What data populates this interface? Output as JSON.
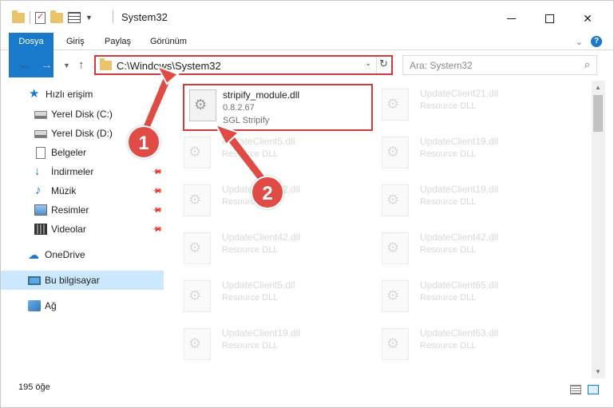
{
  "window": {
    "title": "System32"
  },
  "ribbon": {
    "tabs": [
      "Dosya",
      "Giriş",
      "Paylaş",
      "Görünüm"
    ]
  },
  "nav": {
    "address": "C:\\Windows\\System32",
    "search_placeholder": "Ara: System32"
  },
  "sidebar": {
    "items": [
      {
        "label": "Hızlı erişim",
        "icon": "star-icon"
      },
      {
        "label": "Yerel Disk (C:)",
        "icon": "disk-icon"
      },
      {
        "label": "Yerel Disk (D:)",
        "icon": "disk-icon"
      },
      {
        "label": "Belgeler",
        "icon": "document-icon"
      },
      {
        "label": "İndirmeler",
        "icon": "download-icon"
      },
      {
        "label": "Müzik",
        "icon": "music-icon"
      },
      {
        "label": "Resimler",
        "icon": "pictures-icon"
      },
      {
        "label": "Videolar",
        "icon": "video-icon"
      },
      {
        "label": "OneDrive",
        "icon": "cloud-icon"
      },
      {
        "label": "Bu bilgisayar",
        "icon": "computer-icon"
      },
      {
        "label": "Ağ",
        "icon": "network-icon"
      }
    ],
    "selected": "Bu bilgisayar"
  },
  "files": {
    "main": {
      "name": "stripify_module.dll",
      "version": "0.8.2.67",
      "company": "SGL Stripify"
    },
    "left_col": [
      {
        "name": "UpdateClient5.dll",
        "type": "Resource DLL"
      },
      {
        "name": "UpdateClient42.dll",
        "type": "Resource DLL"
      },
      {
        "name": "UpdateClient42.dll",
        "type": "Resource DLL"
      },
      {
        "name": "UpdateClient5.dll",
        "type": "Resource DLL"
      },
      {
        "name": "UpdateClient19.dll",
        "type": "Resource DLL"
      }
    ],
    "right_col": [
      {
        "name": "UpdateClient21.dll",
        "type": "Resource DLL"
      },
      {
        "name": "UpdateClient19.dll",
        "type": "Resource DLL"
      },
      {
        "name": "UpdateClient19.dll",
        "type": "Resource DLL"
      },
      {
        "name": "UpdateClient42.dll",
        "type": "Resource DLL"
      },
      {
        "name": "UpdateClient65.dll",
        "type": "Resource DLL"
      },
      {
        "name": "UpdateClient63.dll",
        "type": "Resource DLL"
      }
    ]
  },
  "status": {
    "count": "195 öğe"
  },
  "annotations": {
    "badge1": "1",
    "badge2": "2",
    "color": "#e04b45"
  }
}
